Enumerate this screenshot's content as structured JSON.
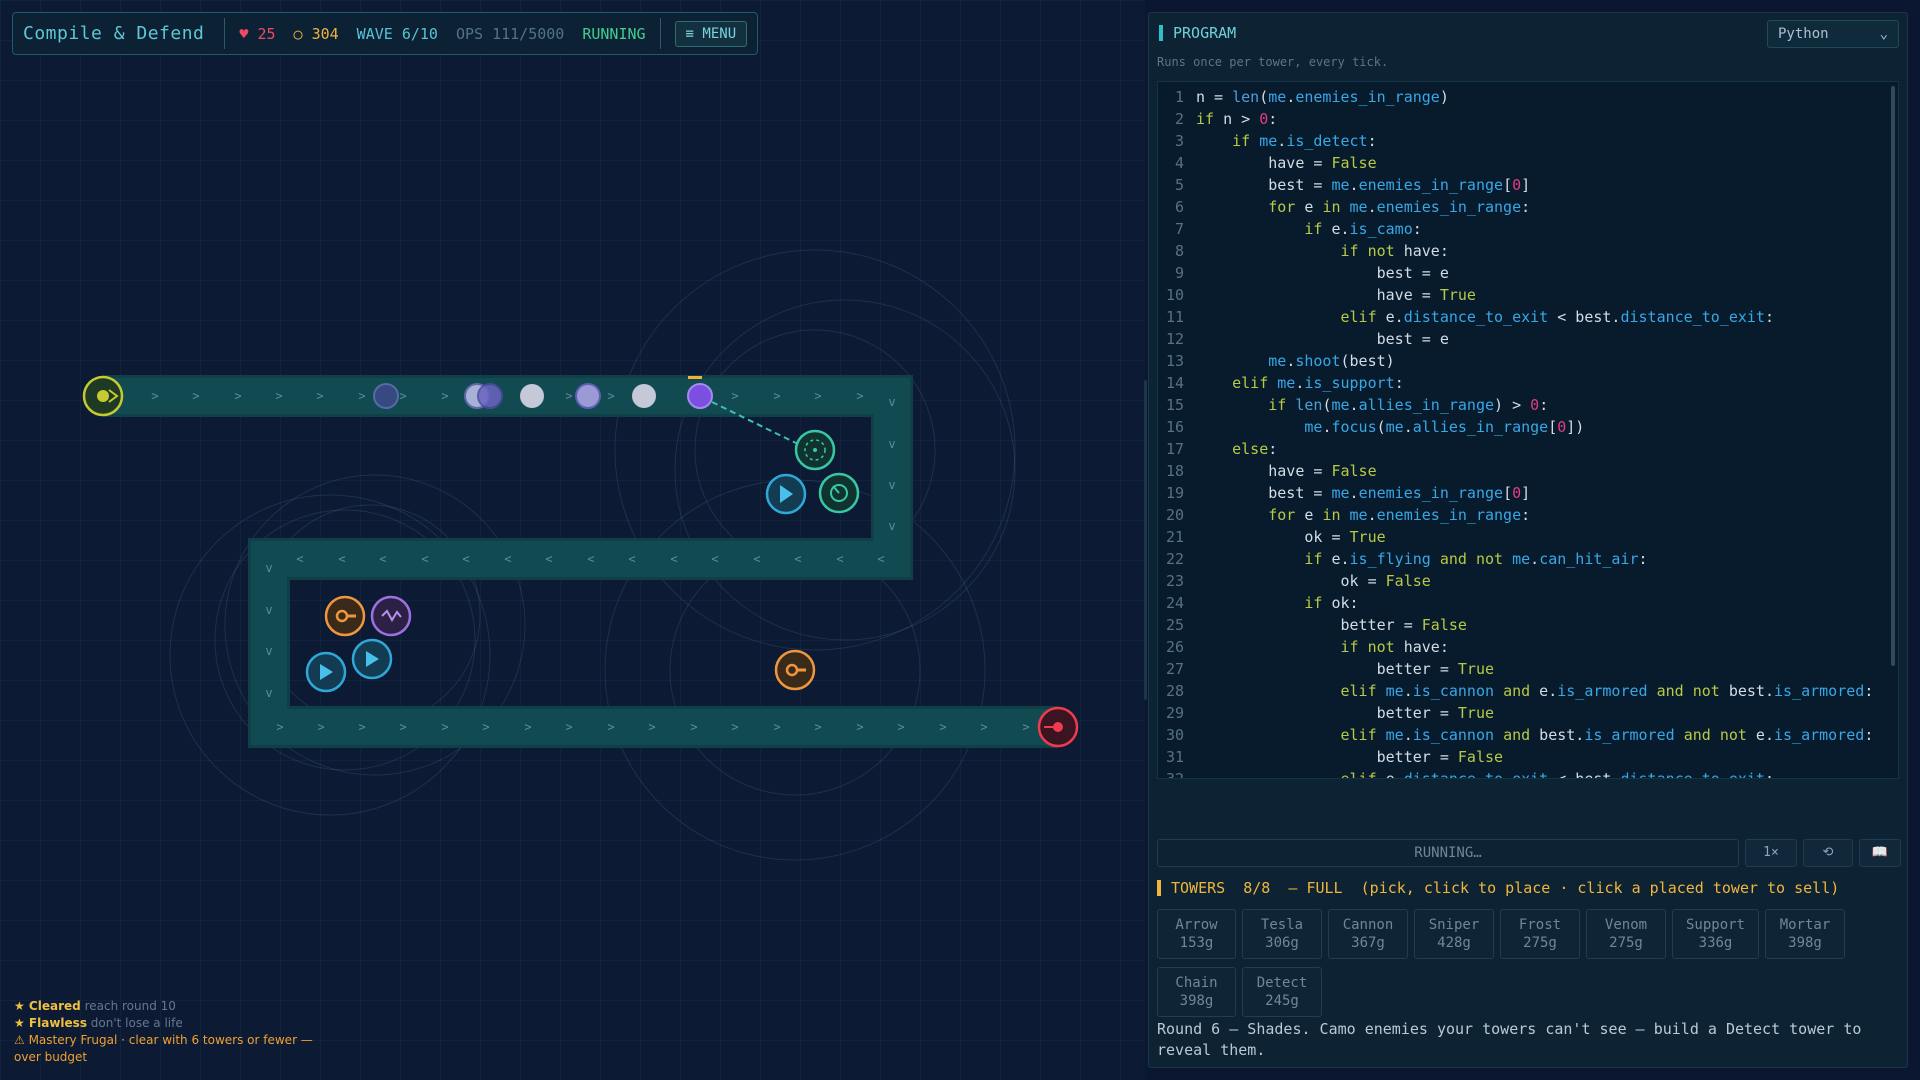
{
  "hud": {
    "title": "Compile & Defend",
    "lives": "♥ 25",
    "gold": "○ 304",
    "wave": "WAVE 6/10",
    "ops": "OPS 111/5000",
    "status": "RUNNING",
    "menu_label": "≡ MENU"
  },
  "map": {
    "path_arrows_right": ">",
    "path_arrows_left": "<",
    "path_arrows_down": "v"
  },
  "achievements": {
    "cleared_title": "★ Cleared",
    "cleared_desc": " reach round 10",
    "flawless_title": "★ Flawless",
    "flawless_desc": " don't lose a life",
    "mastery": "⚠ Mastery Frugal · clear with 6 towers or fewer — over budget"
  },
  "program": {
    "title": "PROGRAM",
    "language": "Python",
    "hint": "Runs once per tower, every tick.",
    "code": [
      "n = len(me.enemies_in_range)",
      "if n > 0:",
      "    if me.is_detect:",
      "        have = False",
      "        best = me.enemies_in_range[0]",
      "        for e in me.enemies_in_range:",
      "            if e.is_camo:",
      "                if not have:",
      "                    best = e",
      "                    have = True",
      "                elif e.distance_to_exit < best.distance_to_exit:",
      "                    best = e",
      "        me.shoot(best)",
      "    elif me.is_support:",
      "        if len(me.allies_in_range) > 0:",
      "            me.focus(me.allies_in_range[0])",
      "    else:",
      "        have = False",
      "        best = me.enemies_in_range[0]",
      "        for e in me.enemies_in_range:",
      "            ok = True",
      "            if e.is_flying and not me.can_hit_air:",
      "                ok = False",
      "            if ok:",
      "                better = False",
      "                if not have:",
      "                    better = True",
      "                elif me.is_cannon and e.is_armored and not best.is_armored:",
      "                    better = True",
      "                elif me.is_cannon and best.is_armored and not e.is_armored:",
      "                    better = False",
      "                elif e.distance_to_exit < best.distance_to_exit:"
    ]
  },
  "controls": {
    "run_status": "RUNNING…",
    "speed": "1×",
    "reset": "⟲",
    "docs": "📖"
  },
  "towers": {
    "header": "TOWERS  8/8  — FULL  (pick, click to place · click a placed tower to sell)",
    "items": [
      {
        "name": "Arrow",
        "cost": "153g"
      },
      {
        "name": "Tesla",
        "cost": "306g"
      },
      {
        "name": "Cannon",
        "cost": "367g"
      },
      {
        "name": "Sniper",
        "cost": "428g"
      },
      {
        "name": "Frost",
        "cost": "275g"
      },
      {
        "name": "Venom",
        "cost": "275g"
      },
      {
        "name": "Support",
        "cost": "336g"
      },
      {
        "name": "Mortar",
        "cost": "398g"
      },
      {
        "name": "Chain",
        "cost": "398g"
      },
      {
        "name": "Detect",
        "cost": "245g"
      }
    ]
  },
  "round_info": "Round 6 — Shades. Camo enemies your towers can't see — build a Detect tower to reveal them.",
  "colors": {
    "path": "#0f4248",
    "accent": "#2fbfca",
    "gold": "#f0b63c",
    "danger": "#ef4a63",
    "ok": "#3fcf8e"
  }
}
